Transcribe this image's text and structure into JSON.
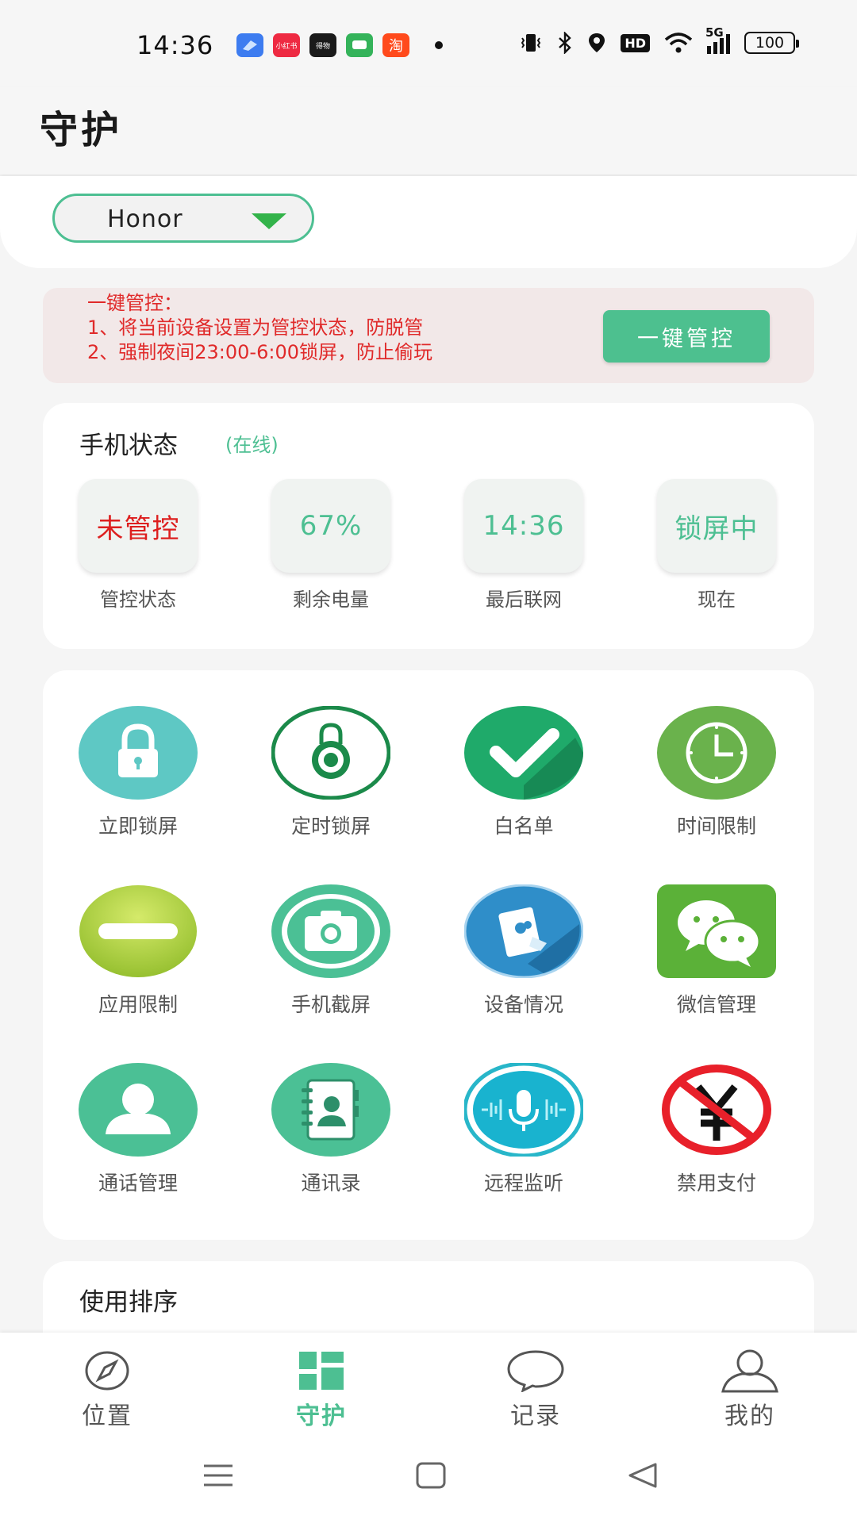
{
  "status_bar": {
    "time": "14:36",
    "apps": [
      {
        "name": "feishu-icon",
        "color": "#3d7cf0",
        "label": ""
      },
      {
        "name": "xiaohongshu-icon",
        "color": "#ee2a42",
        "label": "小红书"
      },
      {
        "name": "dewu-icon",
        "color": "#1a1a1a",
        "label": "得物"
      },
      {
        "name": "message-icon",
        "color": "#34b35a",
        "label": ""
      },
      {
        "name": "taobao-icon",
        "color": "#ff4a1c",
        "label": "淘"
      }
    ],
    "network": "5G",
    "hd": "HD",
    "battery": "100"
  },
  "header": {
    "title": "守护"
  },
  "device_selector": {
    "value": "Honor"
  },
  "banner": {
    "line1": "一键管控：",
    "line2": "1、将当前设备设置为管控状态，防脱管",
    "line3": "2、强制夜间23:00-6:00锁屏，防止偷玩",
    "button_label": "一键管控"
  },
  "phone_status": {
    "title": "手机状态",
    "online": "(在线)",
    "items": [
      {
        "value": "未管控",
        "label": "管控状态"
      },
      {
        "value": "67%",
        "label": "剩余电量"
      },
      {
        "value": "14:36",
        "label": "最后联网"
      },
      {
        "value": "锁屏中",
        "label": "现在"
      }
    ]
  },
  "functions": [
    {
      "label": "立即锁屏",
      "icon": "padlock-icon"
    },
    {
      "label": "定时锁屏",
      "icon": "combination-lock-icon"
    },
    {
      "label": "白名单",
      "icon": "checkmark-icon"
    },
    {
      "label": "时间限制",
      "icon": "clock-icon"
    },
    {
      "label": "应用限制",
      "icon": "minus-icon"
    },
    {
      "label": "手机截屏",
      "icon": "camera-icon"
    },
    {
      "label": "设备情况",
      "icon": "tablet-device-icon"
    },
    {
      "label": "微信管理",
      "icon": "wechat-icon"
    },
    {
      "label": "通话管理",
      "icon": "person-icon"
    },
    {
      "label": "通讯录",
      "icon": "contacts-book-icon"
    },
    {
      "label": "远程监听",
      "icon": "microphone-icon"
    },
    {
      "label": "禁用支付",
      "icon": "no-yuan-icon"
    }
  ],
  "usage": {
    "title": "使用排序"
  },
  "bottom_nav": [
    {
      "label": "位置",
      "icon": "compass-icon",
      "active": false
    },
    {
      "label": "守护",
      "icon": "dashboard-icon",
      "active": true
    },
    {
      "label": "记录",
      "icon": "chat-bubble-icon",
      "active": false
    },
    {
      "label": "我的",
      "icon": "user-icon",
      "active": false
    }
  ],
  "colors": {
    "accent": "#4dbf92",
    "alert_red": "#e02a2a",
    "banner_bg": "#f2e8e8"
  }
}
